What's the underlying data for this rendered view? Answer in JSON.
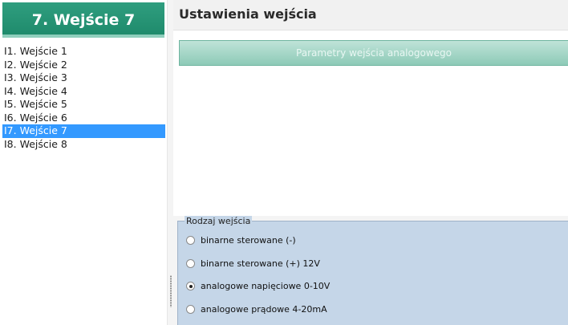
{
  "left_panel": {
    "header": "7. Wejście 7",
    "items": [
      {
        "label": "I1. Wejście 1"
      },
      {
        "label": "I2. Wejście 2"
      },
      {
        "label": "I3. Wejście 3"
      },
      {
        "label": "I4. Wejście 4"
      },
      {
        "label": "I5. Wejście 5"
      },
      {
        "label": "I6. Wejście 6"
      },
      {
        "label": "I7. Wejście 7",
        "selected": true
      },
      {
        "label": "I8. Wejście 8"
      }
    ]
  },
  "right_panel": {
    "title": "Ustawienia wejścia",
    "param_button": "Parametry wejścia analogowego",
    "input_type_group": {
      "legend": "Rodzaj wejścia",
      "options": [
        {
          "label": "binarne sterowane (-)",
          "checked": false
        },
        {
          "label": "binarne sterowane (+) 12V",
          "checked": false
        },
        {
          "label": "analogowe napięciowe 0-10V",
          "checked": true
        },
        {
          "label": "analogowe prądowe 4-20mA",
          "checked": false
        }
      ]
    }
  },
  "colors": {
    "header_green": "#2f9e7f",
    "selection_blue": "#3399ff",
    "group_background": "#c5d6e8"
  }
}
